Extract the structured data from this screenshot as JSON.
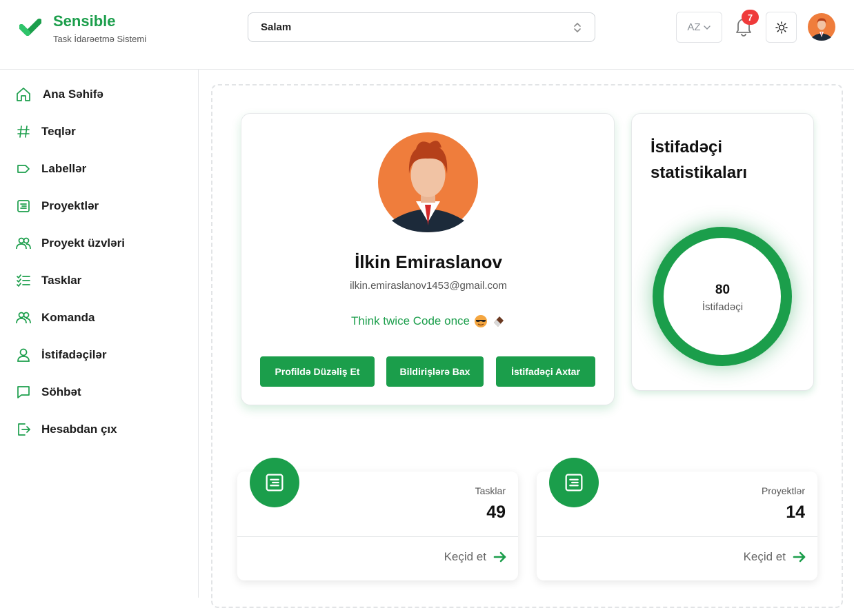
{
  "brand": {
    "name": "Sensible",
    "subtitle": "Task İdarəetmə Sistemi"
  },
  "header": {
    "project_select": "Salam",
    "language": "AZ",
    "notification_count": "7"
  },
  "sidebar": {
    "items": [
      {
        "label": "Ana Səhifə",
        "icon": "home-icon"
      },
      {
        "label": "Teqlər",
        "icon": "hash-icon"
      },
      {
        "label": "Labellər",
        "icon": "label-icon"
      },
      {
        "label": "Proyektlər",
        "icon": "project-icon"
      },
      {
        "label": "Proyekt üzvləri",
        "icon": "users-icon"
      },
      {
        "label": "Tasklar",
        "icon": "checklist-icon"
      },
      {
        "label": "Komanda",
        "icon": "team-icon"
      },
      {
        "label": "İstifadəçilər",
        "icon": "user-icon"
      },
      {
        "label": "Söhbət",
        "icon": "chat-icon"
      },
      {
        "label": "Hesabdan çıx",
        "icon": "logout-icon"
      }
    ]
  },
  "profile": {
    "name": "İlkin Emiraslanov",
    "email": "ilkin.emiraslanov1453@gmail.com",
    "bio": "Think twice Code once",
    "buttons": {
      "edit": "Profildə Düzəliş Et",
      "notifications": "Bildirişlərə Bax",
      "search_user": "İstifadəçi Axtar"
    }
  },
  "stats": {
    "title": "İstifadəçi statistikaları",
    "value": "80",
    "label": "İstifadəçi"
  },
  "cards": [
    {
      "label": "Tasklar",
      "value": "49",
      "link": "Keçid et"
    },
    {
      "label": "Proyektlər",
      "value": "14",
      "link": "Keçid et"
    }
  ],
  "colors": {
    "accent": "#1b9e4b",
    "badge": "#ef3b3b"
  }
}
